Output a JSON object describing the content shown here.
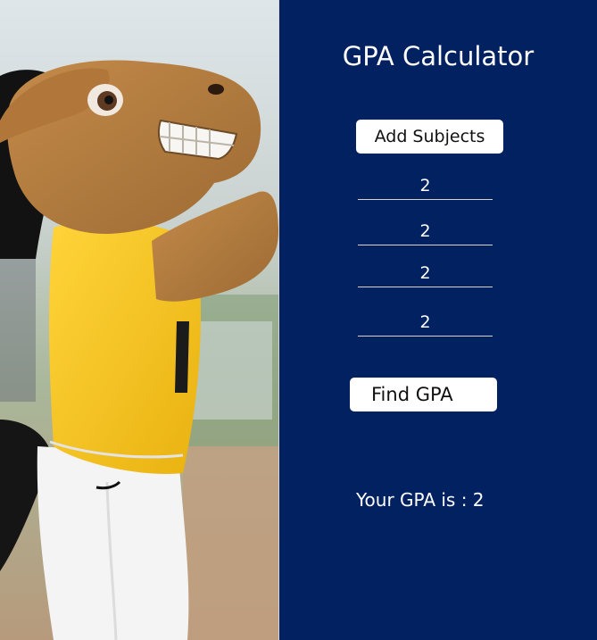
{
  "app": {
    "title": "GPA Calculator"
  },
  "photo": {
    "subject": "mascot-photo"
  },
  "actions": {
    "add_label": "Add Subjects",
    "find_label": "Find GPA"
  },
  "grades": [
    {
      "value": "2"
    },
    {
      "value": "2"
    },
    {
      "value": "2"
    },
    {
      "value": "2"
    }
  ],
  "result": {
    "text": "Your GPA is : 2"
  },
  "colors": {
    "panel_bg": "#012160",
    "button_bg": "#ffffff",
    "text": "#ffffff",
    "jersey": "#f7c21c",
    "fur": "#b27a3c"
  }
}
